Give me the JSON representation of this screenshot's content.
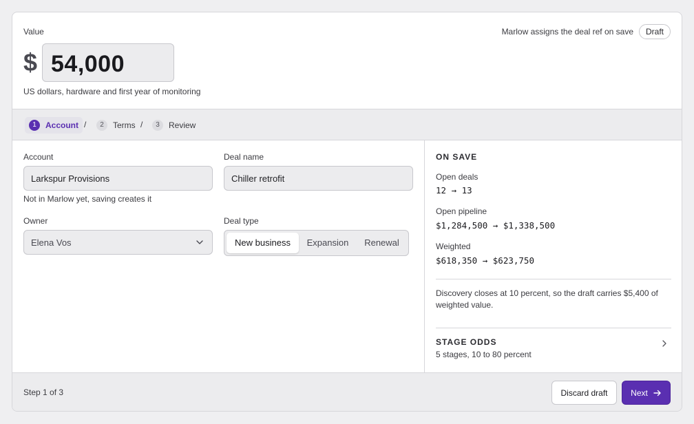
{
  "header": {
    "value_label": "Value",
    "currency_symbol": "$",
    "amount": "54,000",
    "value_help": "US dollars, hardware and first year of monitoring",
    "ref_note": "Marlow assigns the deal ref on save",
    "status_badge": "Draft"
  },
  "stepper": {
    "steps": [
      {
        "number": "1",
        "label": "Account",
        "active": true
      },
      {
        "number": "2",
        "label": "Terms",
        "active": false
      },
      {
        "number": "3",
        "label": "Review",
        "active": false
      }
    ],
    "separator": "/"
  },
  "form": {
    "account": {
      "label": "Account",
      "value": "Larkspur Provisions",
      "hint": "Not in Marlow yet, saving creates it"
    },
    "deal_name": {
      "label": "Deal name",
      "value": "Chiller retrofit"
    },
    "owner": {
      "label": "Owner",
      "value": "Elena Vos",
      "icon": "chevron-down-icon"
    },
    "deal_type": {
      "label": "Deal type",
      "options": [
        "New business",
        "Expansion",
        "Renewal"
      ],
      "selected": "New business"
    }
  },
  "side_panel": {
    "title": "ON SAVE",
    "metrics": [
      {
        "label": "Open deals",
        "value": "12 → 13"
      },
      {
        "label": "Open pipeline",
        "value": "$1,284,500 → $1,338,500"
      },
      {
        "label": "Weighted",
        "value": "$618,350 → $623,750"
      }
    ],
    "note": "Discovery closes at 10 percent, so the draft carries $5,400 of weighted value.",
    "stage_odds": {
      "title": "STAGE ODDS",
      "subtitle": "5 stages, 10 to 80 percent",
      "icon": "chevron-right-icon"
    }
  },
  "footer": {
    "step_count": "Step 1 of 3",
    "discard_label": "Discard draft",
    "next_label": "Next",
    "next_icon": "arrow-right-icon"
  },
  "colors": {
    "accent": "#5a2fb1",
    "panel_background": "#ececee",
    "border": "#d6d6da"
  }
}
